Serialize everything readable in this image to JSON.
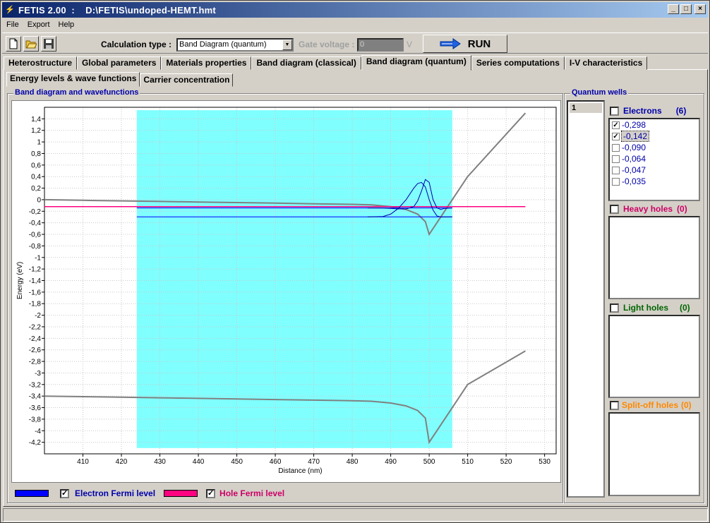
{
  "window": {
    "title": "FETIS 2.00  :    D:\\FETIS\\undoped-HEMT.hmt"
  },
  "menu": [
    "File",
    "Export",
    "Help"
  ],
  "toolbar": {
    "calc_label": "Calculation type :",
    "calc_value": "Band Diagram (quantum)",
    "gate_label": "Gate voltage :",
    "gate_value": "0",
    "gate_unit": "V",
    "run_label": "RUN"
  },
  "tabs": [
    "Heterostructure",
    "Global parameters",
    "Materials properties",
    "Band diagram (classical)",
    "Band diagram (quantum)",
    "Series computations",
    "I-V characteristics"
  ],
  "active_tab": "Band diagram (quantum)",
  "subtabs": [
    "Energy levels & wave functions",
    "Carrier concentration"
  ],
  "plot_title": "Band diagram and wavefunctions",
  "legend": {
    "electron_label": "Electron Fermi level",
    "hole_label": "Hole Fermi level",
    "electron_color": "#0000ff",
    "hole_color": "#ff0080"
  },
  "quantum_wells": {
    "title": "Quantum wells",
    "items": [
      "1"
    ],
    "electrons": {
      "label": "Electrons",
      "count": "(6)",
      "color": "#0000aa",
      "levels": [
        {
          "value": "-0,298",
          "checked": true
        },
        {
          "value": "-0,142",
          "checked": true
        },
        {
          "value": "-0,090",
          "checked": false
        },
        {
          "value": "-0,064",
          "checked": false
        },
        {
          "value": "-0,047",
          "checked": false
        },
        {
          "value": "-0,035",
          "checked": false
        }
      ]
    },
    "heavy_holes": {
      "label": "Heavy holes",
      "count": "(0)",
      "color": "#cc0066"
    },
    "light_holes": {
      "label": "Light holes",
      "count": "(0)",
      "color": "#006600"
    },
    "split_off_holes": {
      "label": "Split-off holes",
      "count": "(0)",
      "color": "#ff8800"
    }
  },
  "chart_data": {
    "type": "line",
    "xlabel": "Distance (nm)",
    "ylabel": "Energy (eV)",
    "xlim": [
      400,
      533
    ],
    "ylim": [
      -4.4,
      1.6
    ],
    "xticks": [
      "410",
      "420",
      "430",
      "440",
      "450",
      "460",
      "470",
      "480",
      "490",
      "500",
      "510",
      "520",
      "530"
    ],
    "yticks": [
      "1,4",
      "1,2",
      "1",
      "0,8",
      "0,6",
      "0,4",
      "0,2",
      "0",
      "-0,2",
      "-0,4",
      "-0,6",
      "-0,8",
      "-1",
      "-1,2",
      "-1,4",
      "-1,6",
      "-1,8",
      "-2",
      "-2,2",
      "-2,4",
      "-2,6",
      "-2,8",
      "-3",
      "-3,2",
      "-3,4",
      "-3,6",
      "-3,8",
      "-4",
      "-4,2"
    ],
    "grid": true,
    "highlight_region": {
      "x": [
        424,
        506
      ],
      "color": "#80ffff"
    },
    "series": [
      {
        "role": "conduction-band",
        "color": "#808080",
        "x": [
          400,
          410,
          420,
          430,
          440,
          450,
          460,
          470,
          480,
          485,
          490,
          494,
          497,
          499,
          500,
          502,
          510,
          525
        ],
        "y": [
          0.0,
          -0.01,
          -0.02,
          -0.03,
          -0.04,
          -0.05,
          -0.06,
          -0.07,
          -0.08,
          -0.09,
          -0.12,
          -0.17,
          -0.25,
          -0.38,
          -0.6,
          -0.4,
          0.4,
          1.5
        ]
      },
      {
        "role": "valence-band",
        "color": "#808080",
        "x": [
          400,
          410,
          420,
          430,
          440,
          450,
          460,
          470,
          480,
          485,
          490,
          494,
          497,
          499,
          500,
          502,
          510,
          525
        ],
        "y": [
          -3.4,
          -3.41,
          -3.42,
          -3.43,
          -3.44,
          -3.45,
          -3.46,
          -3.47,
          -3.48,
          -3.49,
          -3.52,
          -3.57,
          -3.65,
          -3.78,
          -4.2,
          -4.0,
          -3.2,
          -2.62
        ]
      },
      {
        "role": "fermi-level",
        "color": "#ff0080",
        "x": [
          400,
          525
        ],
        "y": [
          -0.12,
          -0.12
        ]
      },
      {
        "role": "electron-level-1",
        "color": "#0000ff",
        "x": [
          424,
          506
        ],
        "y": [
          -0.298,
          -0.298
        ]
      },
      {
        "role": "electron-level-2",
        "color": "#0000ff",
        "x": [
          424,
          506
        ],
        "y": [
          -0.142,
          -0.142
        ]
      },
      {
        "role": "wavefunction-1",
        "color": "#0000aa",
        "x": [
          484,
          488,
          490,
          492,
          494,
          496,
          497,
          498,
          499,
          500,
          501,
          502,
          503,
          504,
          506
        ],
        "y": [
          -0.298,
          -0.29,
          -0.25,
          -0.15,
          0.0,
          0.2,
          0.28,
          0.3,
          0.22,
          0.0,
          -0.18,
          -0.28,
          -0.3,
          -0.299,
          -0.298
        ]
      },
      {
        "role": "wavefunction-2",
        "color": "#0000aa",
        "x": [
          484,
          488,
          490,
          492,
          494,
          496,
          497,
          498,
          499,
          500,
          501,
          502,
          503,
          504,
          506
        ],
        "y": [
          -0.142,
          -0.145,
          -0.15,
          -0.16,
          -0.16,
          -0.12,
          -0.02,
          0.15,
          0.35,
          0.3,
          0.0,
          -0.14,
          -0.17,
          -0.15,
          -0.142
        ]
      }
    ]
  }
}
